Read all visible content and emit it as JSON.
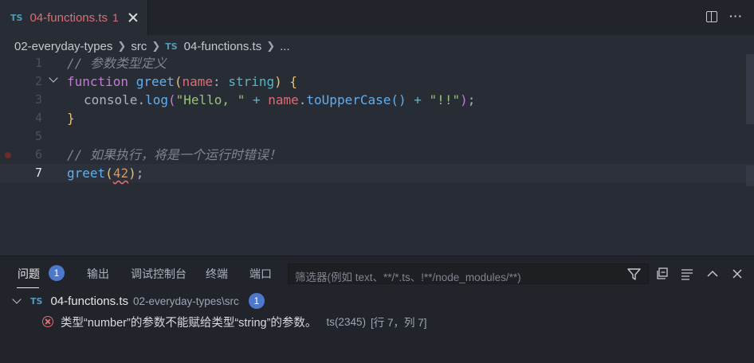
{
  "tab": {
    "badge": "TS",
    "title": "04-functions.ts",
    "problem_count": "1"
  },
  "breadcrumb": {
    "items": [
      "02-everyday-types",
      "src",
      "04-functions.ts",
      "..."
    ],
    "file_badge": "TS"
  },
  "editor": {
    "line_numbers": [
      "1",
      "2",
      "3",
      "4",
      "5",
      "6",
      "7"
    ],
    "active_line": "7",
    "lines": {
      "l1": "// 参数类型定义",
      "l2": {
        "kw": "function",
        "fn": "greet",
        "open": "(",
        "param": "name",
        "colon": ": ",
        "type": "string",
        "close": ")",
        "brace": " {"
      },
      "l3": {
        "obj": "console",
        "dot": ".",
        "method": "log",
        "open": "(",
        "s1": "\"Hello, \"",
        "plus1": " + ",
        "var": "name",
        "dot2": ".",
        "m2": "toUpperCase",
        "call": "()",
        "plus2": " + ",
        "s2": "\"!!\"",
        "close": ")",
        "semi": ";"
      },
      "l4": "}",
      "l6": "// 如果执行，将是一个运行时错误！",
      "l7": {
        "fn": "greet",
        "open": "(",
        "arg": "42",
        "close": ")",
        "semi": ";"
      }
    }
  },
  "panel": {
    "tabs": [
      "问题",
      "输出",
      "调试控制台",
      "终端",
      "端口"
    ],
    "problems_badge": "1",
    "filter_placeholder": "筛选器(例如 text、**/*.ts、!**/node_modules/**)",
    "file": {
      "badge": "TS",
      "name": "04-functions.ts",
      "path": "02-everyday-types\\src",
      "count": "1"
    },
    "error": {
      "message": "类型“number”的参数不能赋给类型“string”的参数。",
      "code": "ts(2345)",
      "position": "[行 7，列 7]"
    }
  },
  "colors": {
    "accent": "#4d78cc",
    "error": "#e06c75",
    "background": "#282c34"
  }
}
